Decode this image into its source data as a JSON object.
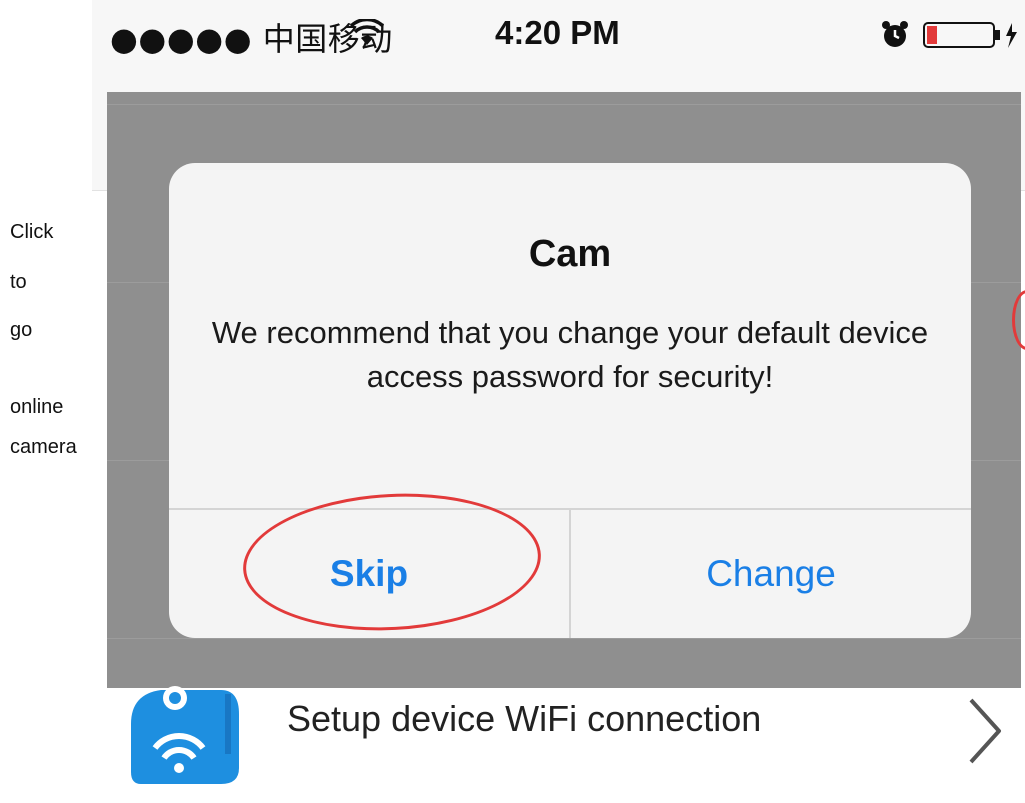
{
  "annotation": {
    "side_note_lines": [
      "Click",
      "to",
      "go",
      "online",
      "camera"
    ]
  },
  "status_bar": {
    "carrier": "●●●●● 中国移动",
    "time": "4:20 PM",
    "icons": [
      "wifi-icon",
      "alarm-icon",
      "battery-icon"
    ],
    "battery_color": "#e23a3a"
  },
  "alert": {
    "title": "Cam",
    "message": "We recommend that you change your default device access password for security!",
    "buttons": {
      "skip": "Skip",
      "change": "Change"
    },
    "button_color": "#1a7fe6"
  },
  "list": {
    "item_label": "Setup device WiFi connection",
    "item_icon": "camera-wifi-icon"
  },
  "colors": {
    "overlay": "#8f8f8f",
    "annotation_red": "#e23a3a"
  }
}
